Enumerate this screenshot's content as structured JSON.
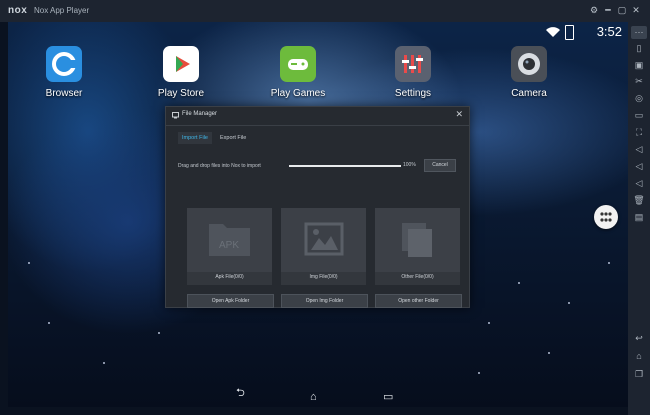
{
  "titlebar": {
    "logo": "nox",
    "title": "Nox App Player",
    "controls": [
      "⚙",
      "━",
      "▢",
      "✕"
    ]
  },
  "status": {
    "time": "3:52"
  },
  "apps": [
    {
      "label": "Browser",
      "icon": "browser-icon",
      "color": "#2a8fe0"
    },
    {
      "label": "Play Store",
      "icon": "play-store-icon",
      "color": "#ffffff"
    },
    {
      "label": "Play Games",
      "icon": "play-games-icon",
      "color": "#6dbb3c"
    },
    {
      "label": "Settings",
      "icon": "settings-icon",
      "color": "#5a6170"
    },
    {
      "label": "Camera",
      "icon": "camera-icon",
      "color": "#4a4f57"
    }
  ],
  "file_manager": {
    "title": "File Manager",
    "tabs": [
      "Import File",
      "Export File"
    ],
    "drag_text": "Drag and drop files into Nox to import",
    "progress_percent": 100,
    "progress_label": "100%",
    "cancel_label": "Cancel",
    "cards": [
      {
        "art_label": "APK",
        "caption": "Apk File(0/0)",
        "button": "Open Apk Folder",
        "icon": "apk-folder-icon"
      },
      {
        "art_label": "",
        "caption": "Img File(0/0)",
        "button": "Open Img Folder",
        "icon": "image-icon"
      },
      {
        "art_label": "",
        "caption": "Other File(0/0)",
        "button": "Open other Folder",
        "icon": "documents-icon"
      }
    ]
  },
  "navbar": {
    "back": "⮌",
    "home": "⌂",
    "recents": "▭"
  },
  "sidebar": {
    "icons": [
      "more-icon",
      "screen-icon",
      "keyboard-icon",
      "scissors-icon",
      "location-icon",
      "display-icon",
      "fullscreen-icon",
      "volume-icon",
      "volume-down-icon",
      "mute-icon",
      "trash-icon",
      "apk-install-icon",
      "back-icon",
      "home-icon",
      "recents-icon"
    ]
  },
  "colors": {
    "accent": "#3fb6e8",
    "dialog_bg": "#262a30"
  }
}
